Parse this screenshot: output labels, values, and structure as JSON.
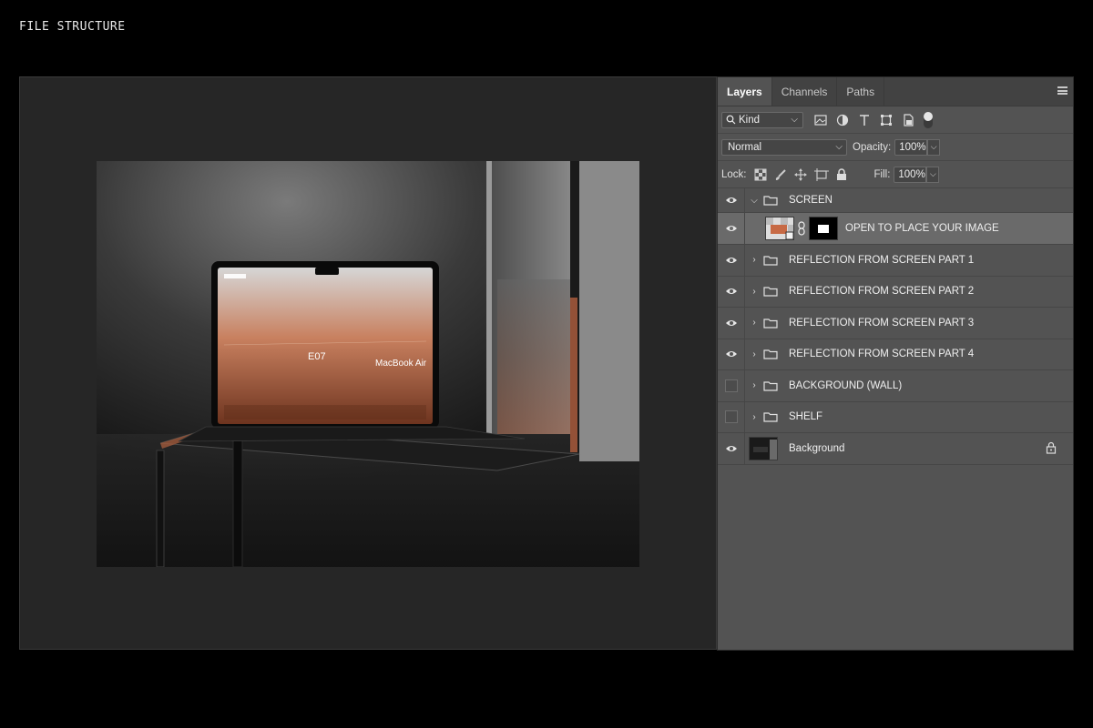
{
  "page_label": "FILE STRUCTURE",
  "panel": {
    "tabs": [
      {
        "label": "Layers",
        "active": true
      },
      {
        "label": "Channels",
        "active": false
      },
      {
        "label": "Paths",
        "active": false
      }
    ],
    "filter": {
      "kind_label": "Kind"
    },
    "blend": {
      "mode": "Normal",
      "opacity_label": "Opacity:",
      "opacity_value": "100%"
    },
    "lock": {
      "label": "Lock:",
      "fill_label": "Fill:",
      "fill_value": "100%"
    }
  },
  "layers": [
    {
      "name": "SCREEN",
      "type": "group",
      "visible": true,
      "expanded": true
    },
    {
      "name": "OPEN TO PLACE YOUR IMAGE",
      "type": "smart-object",
      "visible": true,
      "selected": true
    },
    {
      "name": "REFLECTION FROM SCREEN PART 1",
      "type": "group",
      "visible": true
    },
    {
      "name": "REFLECTION FROM SCREEN PART 2",
      "type": "group",
      "visible": true
    },
    {
      "name": "REFLECTION FROM SCREEN PART 3",
      "type": "group",
      "visible": true
    },
    {
      "name": "REFLECTION FROM SCREEN PART 4",
      "type": "group",
      "visible": true
    },
    {
      "name": "BACKGROUND (WALL)",
      "type": "group",
      "visible": false
    },
    {
      "name": "SHELF",
      "type": "group",
      "visible": false
    },
    {
      "name": "Background",
      "type": "image",
      "visible": true,
      "locked": true
    }
  ],
  "artwork": {
    "screen_model": "E07",
    "screen_product": "MacBook Air",
    "colors": {
      "screen_top": "#cfcfcf",
      "screen_mid": "#c8805f",
      "screen_bottom": "#7a3a22",
      "accent": "#c76a45"
    }
  }
}
